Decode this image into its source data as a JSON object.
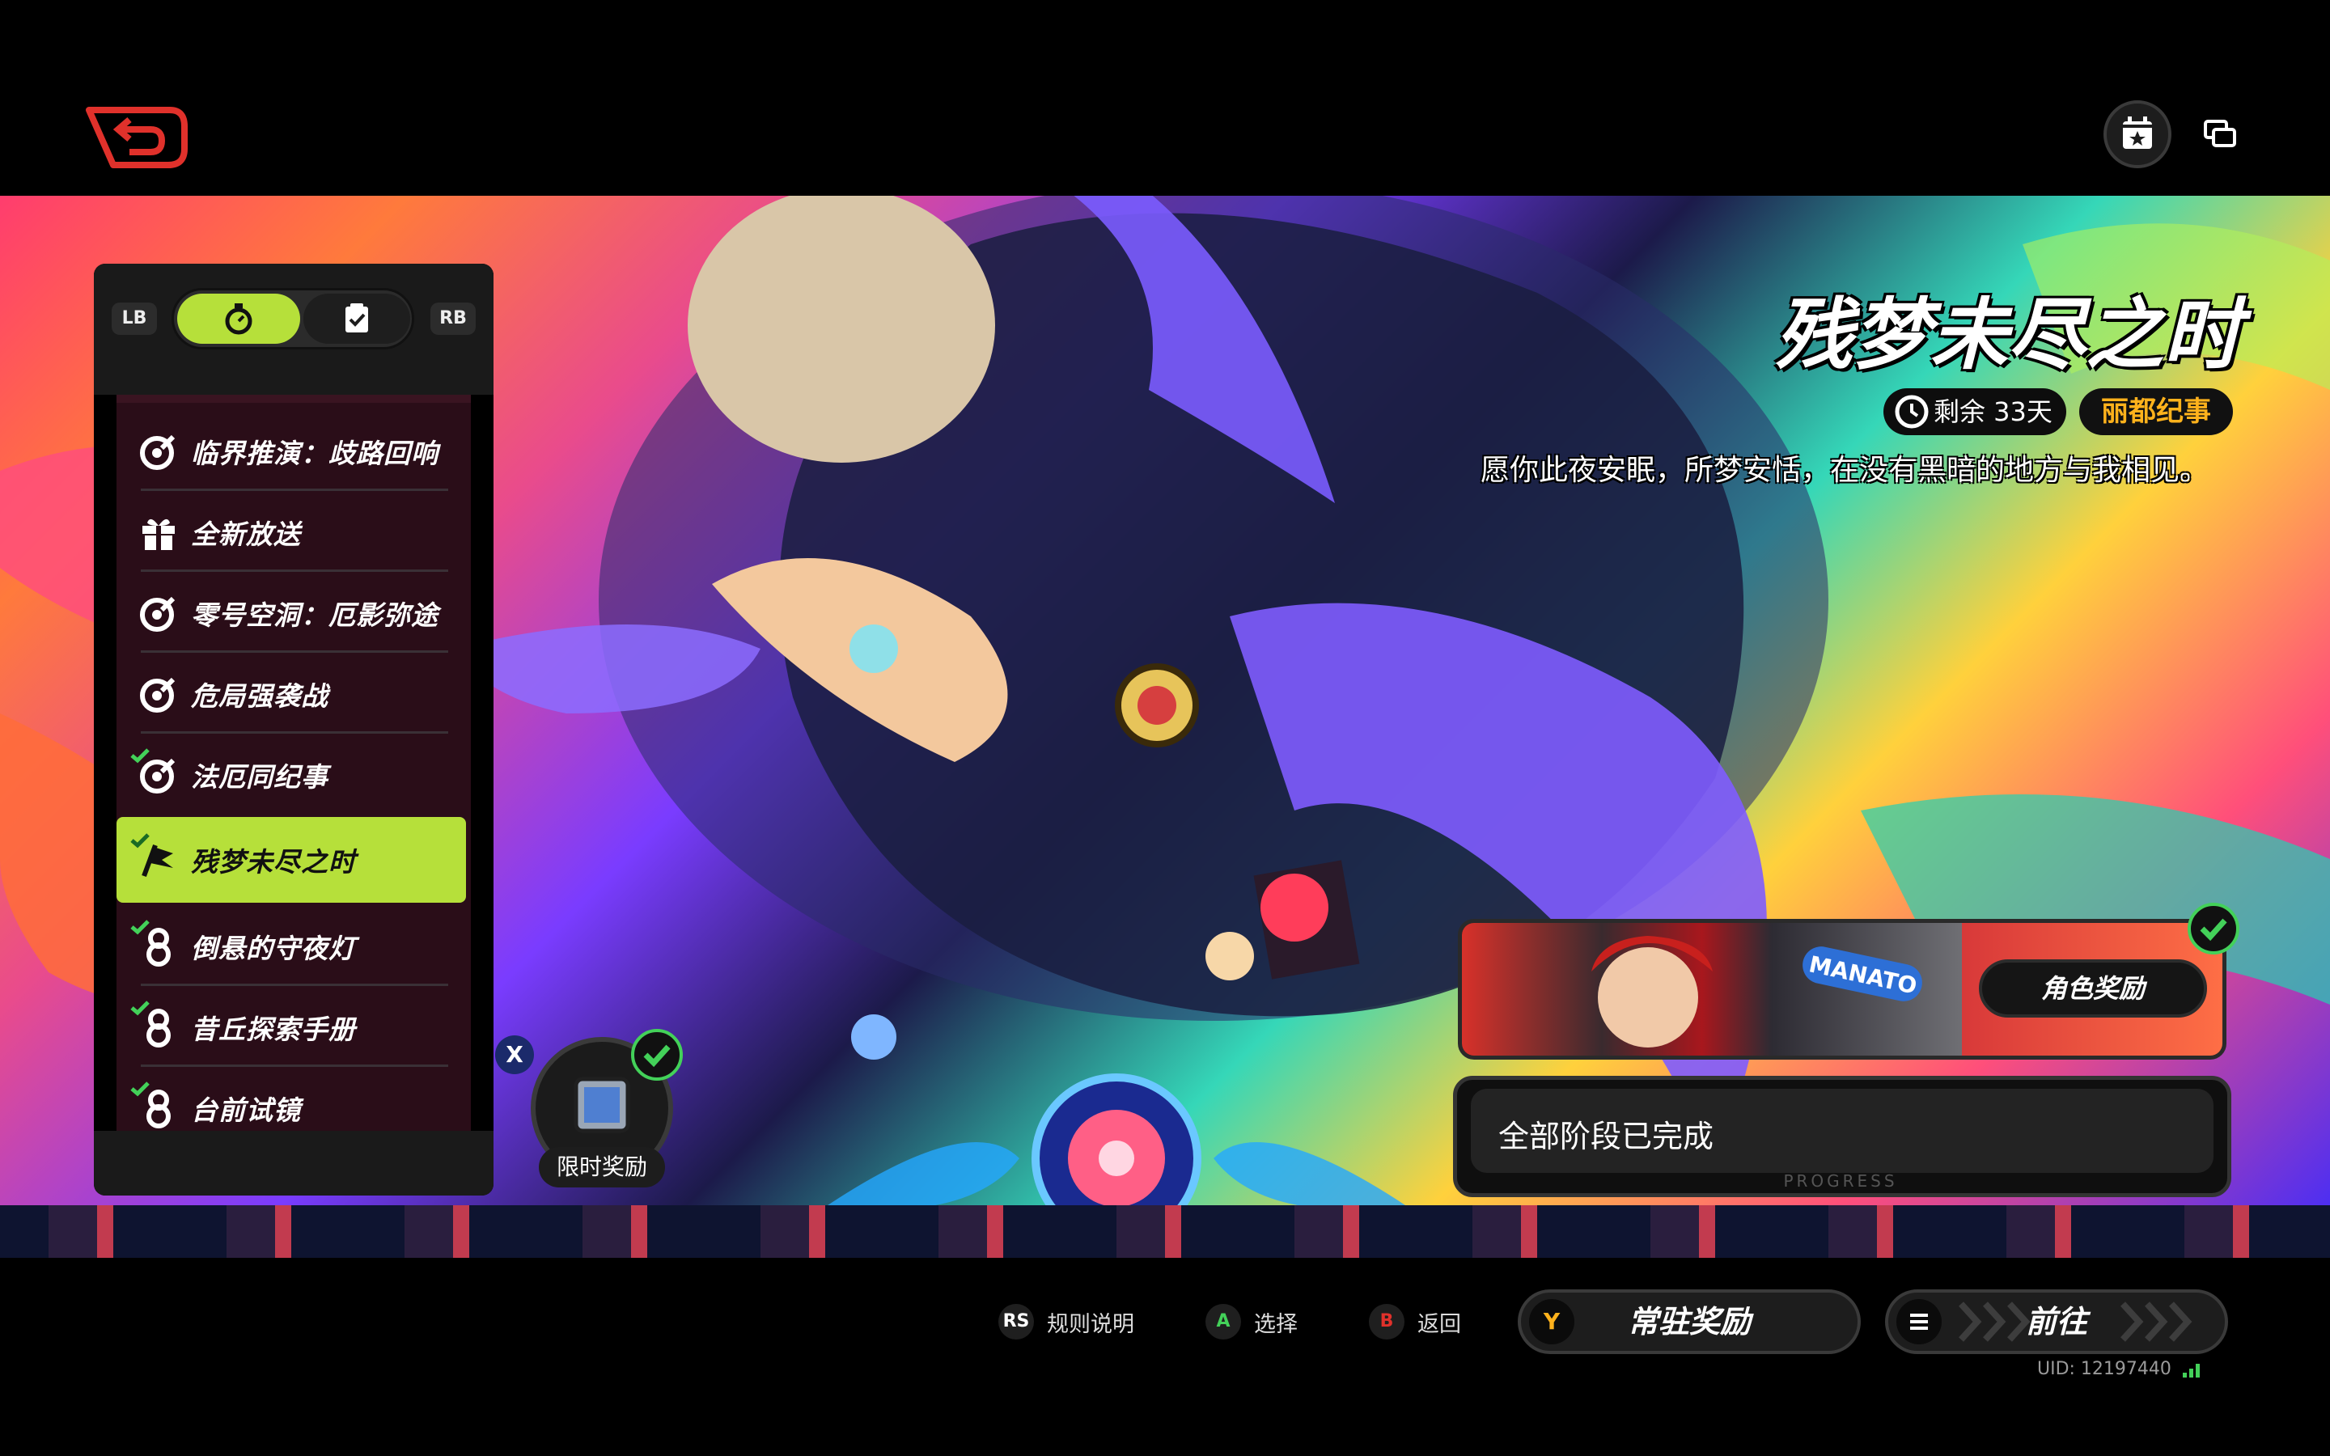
{
  "header": {
    "back_icon": "back-arrow-icon",
    "calendar_icon": "calendar-star-icon",
    "window_icon": "window-switch-icon"
  },
  "left_panel": {
    "lb": "LB",
    "rb": "RB",
    "tabs": [
      "timer-tab",
      "checklist-tab"
    ],
    "items": [
      {
        "label": "临界推演：歧路回响",
        "icon": "target-check-icon",
        "done": false,
        "active": false
      },
      {
        "label": "全新放送",
        "icon": "gift-icon",
        "done": false,
        "active": false
      },
      {
        "label": "零号空洞：厄影弥途",
        "icon": "target-check-icon",
        "done": false,
        "active": false
      },
      {
        "label": "危局强袭战",
        "icon": "target-check-icon",
        "done": false,
        "active": false
      },
      {
        "label": "法厄同纪事",
        "icon": "target-check-icon",
        "done": true,
        "active": false
      },
      {
        "label": "残梦未尽之时",
        "icon": "flag-icon",
        "done": true,
        "active": true
      },
      {
        "label": "倒悬的守夜灯",
        "icon": "eight-icon",
        "done": true,
        "active": false
      },
      {
        "label": "昔丘探索手册",
        "icon": "eight-icon",
        "done": true,
        "active": false
      },
      {
        "label": "台前试镜",
        "icon": "eight-icon",
        "done": true,
        "active": false
      }
    ],
    "x_key": "X",
    "limited_reward": "限时奖励"
  },
  "event": {
    "title": "残梦未尽之时",
    "remaining": "剩余 33天",
    "tag": "丽都纪事",
    "description": "愿你此夜安眠，所梦安恬，在没有黑暗的地方与我相见。",
    "character_reward": "角色奖励",
    "character_banner": "MANATO",
    "progress_text": "全部阶段已完成",
    "progress_label": "PROGRESS"
  },
  "controls": {
    "rules_key": "RS",
    "rules_label": "规则说明",
    "select_key": "A",
    "select_label": "选择",
    "back_key": "B",
    "back_label": "返回",
    "standing_key": "Y",
    "standing_label": "常驻奖励",
    "go_label": "前往",
    "uid": "UID: 12197440"
  },
  "colors": {
    "accent_green": "#b6e03a",
    "tag_orange": "#ffb21c",
    "check_green": "#43d159",
    "back_red": "#e0312b"
  }
}
